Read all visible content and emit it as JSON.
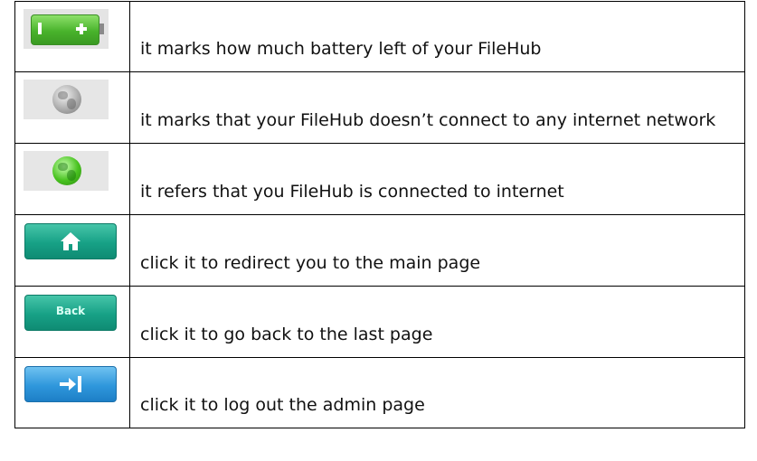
{
  "rows": [
    {
      "icon": "battery-icon",
      "text": "it marks how much battery left of your FileHub"
    },
    {
      "icon": "globe-offline-icon",
      "text": "it marks that your FileHub doesn’t connect to any internet network"
    },
    {
      "icon": "globe-online-icon",
      "text": "it refers that you FileHub is connected to internet"
    },
    {
      "icon": "home-icon",
      "text": "click it to redirect you to the main page"
    },
    {
      "icon": "back-button-icon",
      "label": "Back",
      "text": "click it to go back to the last page"
    },
    {
      "icon": "logout-icon",
      "text": "click it to log out the admin page"
    }
  ],
  "colors": {
    "battery_green": "#49b32c",
    "globe_grey": "#a7a7a7",
    "globe_green": "#48c21f",
    "button_teal": "#17a186",
    "button_blue": "#2f97dc"
  }
}
